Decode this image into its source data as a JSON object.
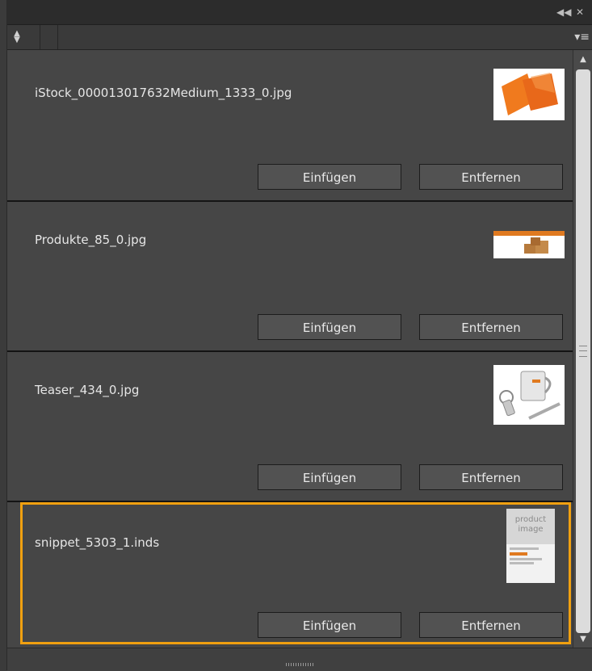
{
  "panel": {
    "titlebar": {
      "collapse_icon": "double-chevron-left-icon",
      "close_icon": "close-icon"
    },
    "tabbar": {
      "sort_icon": "sort-arrows-icon",
      "menu_icon": "panel-menu-icon"
    }
  },
  "items": [
    {
      "filename": "iStock_000013017632Medium_1333_0.jpg",
      "thumbnail": "orange-pillows-thumbnail",
      "insert_label": "Einfügen",
      "remove_label": "Entfernen",
      "selected": false
    },
    {
      "filename": "Produkte_85_0.jpg",
      "thumbnail": "boxes-banner-thumbnail",
      "insert_label": "Einfügen",
      "remove_label": "Entfernen",
      "selected": false
    },
    {
      "filename": "Teaser_434_0.jpg",
      "thumbnail": "mug-keychain-pen-thumbnail",
      "insert_label": "Einfügen",
      "remove_label": "Entfernen",
      "selected": false
    },
    {
      "filename": "snippet_5303_1.inds",
      "thumbnail": "product-image-snippet-thumbnail",
      "thumb_text": "product image",
      "insert_label": "Einfügen",
      "remove_label": "Entfernen",
      "selected": true
    }
  ],
  "colors": {
    "selection_border": "#f0a010",
    "panel_bg": "#464646",
    "button_bg": "#525252"
  }
}
